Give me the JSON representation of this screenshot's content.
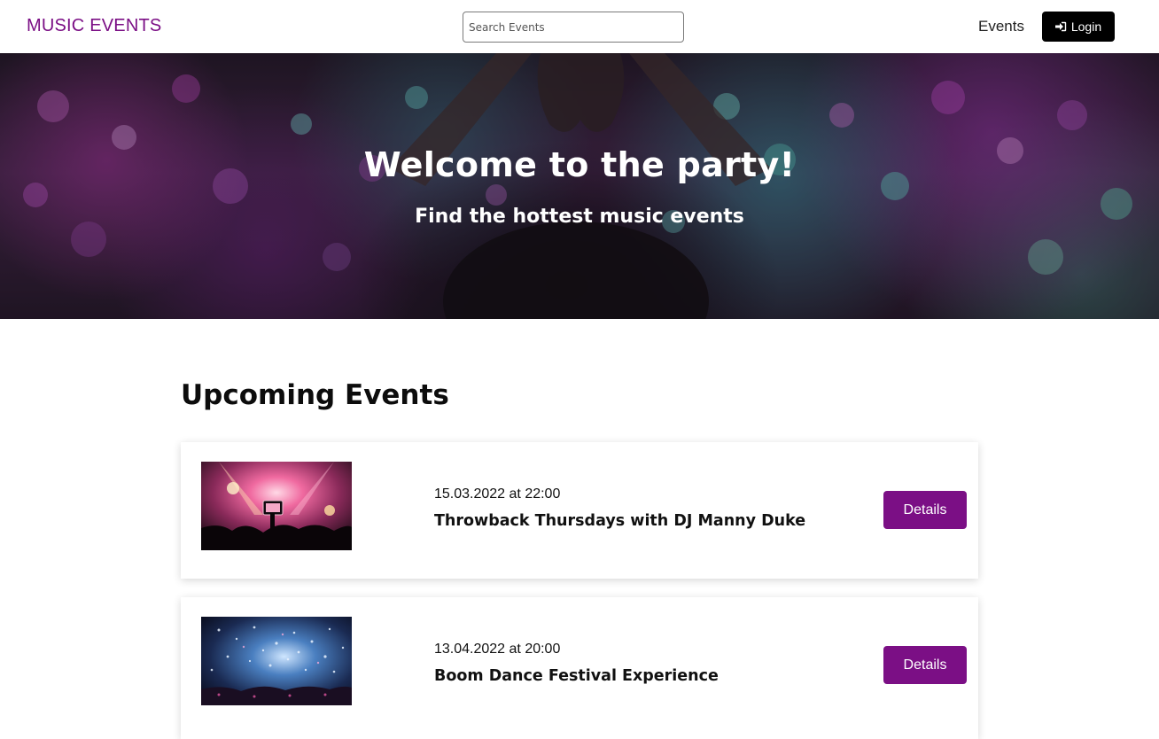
{
  "navbar": {
    "brand": "MUSIC EVENTS",
    "search_placeholder": "Search Events",
    "events_link": "Events",
    "login_label": "Login",
    "brand_color": "#7b0f85"
  },
  "hero": {
    "title": "Welcome to the party!",
    "subtitle": "Find the hottest music events"
  },
  "upcoming": {
    "heading": "Upcoming Events",
    "events": [
      {
        "date": "15.03.2022 at 22:00",
        "title": "Throwback Thursdays with DJ Manny Duke",
        "button": "Details"
      },
      {
        "date": "13.04.2022 at 20:00",
        "title": "Boom Dance Festival Experience",
        "button": "Details"
      }
    ]
  },
  "colors": {
    "accent": "#7b0f85",
    "login_bg": "#000000"
  },
  "icons": {
    "login": "sign-in-icon"
  }
}
